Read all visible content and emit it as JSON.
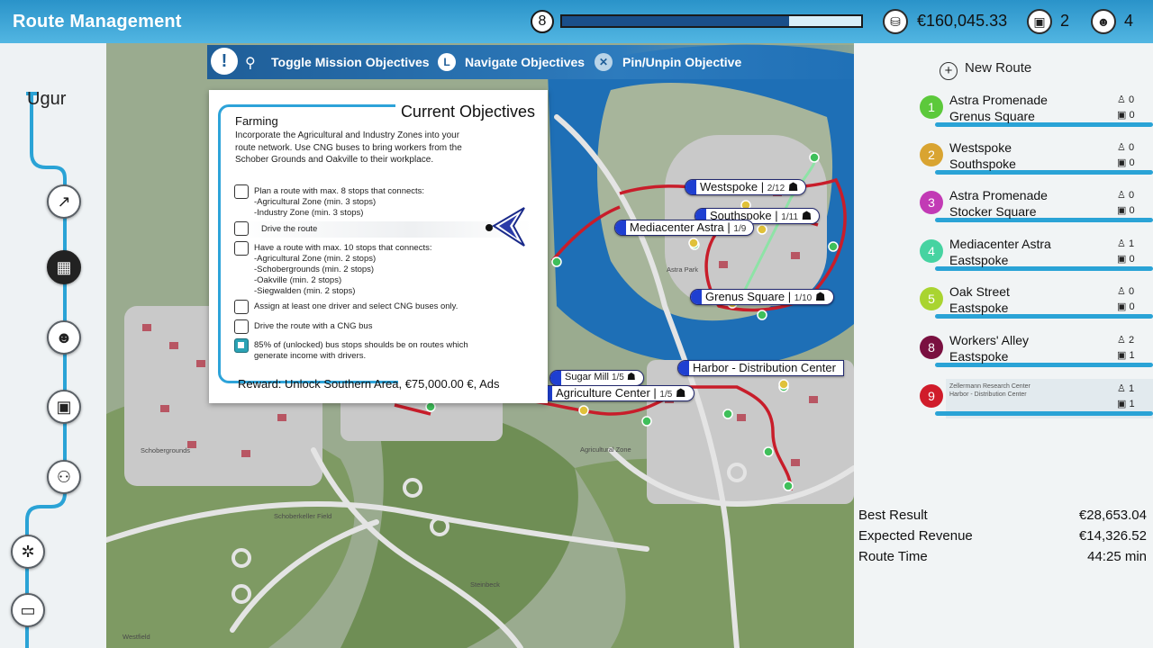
{
  "header": {
    "title": "Route Management",
    "level": "8",
    "xp_progress": 0.76,
    "money": "€160,045.33",
    "buses": "2",
    "drivers": "4"
  },
  "sidebar": {
    "company": "Ugur",
    "items": [
      {
        "icon": "statistics-icon"
      },
      {
        "icon": "map-icon",
        "active": true
      },
      {
        "icon": "driver-icon"
      },
      {
        "icon": "bus-icon"
      },
      {
        "icon": "people-icon"
      },
      {
        "icon": "settings-icon"
      },
      {
        "icon": "monitor-icon"
      }
    ]
  },
  "hints": {
    "toggle": "Toggle Mission Objectives",
    "navigate_key": "L",
    "navigate": "Navigate Objectives",
    "pin_key": "✕",
    "pin": "Pin/Unpin Objective"
  },
  "objectives": {
    "heading": "Current Objectives",
    "mission": "Farming",
    "description": "Incorporate the Agricultural and Industry Zones into your route network. Use CNG buses to bring workers from the Schober Grounds and Oakville to their workplace.",
    "tasks": [
      {
        "text": "Plan a route with max. 8 stops that connects:\n -Agricultural Zone (min. 3 stops)\n -Industry Zone (min. 3 stops)",
        "checked": false
      },
      {
        "text": "Drive the route",
        "checked": false
      },
      {
        "text": "Have a route with max. 10 stops that connects:\n -Agricultural Zone (min. 2 stops)\n -Schobergrounds (min. 2 stops)\n -Oakville (min. 2 stops)\n -Siegwalden (min. 2 stops)",
        "checked": false
      },
      {
        "text": "Assign at least one driver and select CNG buses only.",
        "checked": false
      },
      {
        "text": "Drive the route with a CNG bus",
        "checked": false
      },
      {
        "text": "85% of (unlocked) bus stops shoulds be on routes which generate income with drivers.",
        "checked": true
      }
    ],
    "reward": "Reward: Unlock Southern Area, €75,000.00 €, Ads"
  },
  "map_labels": [
    {
      "name": "Westspoke",
      "count": "2/12"
    },
    {
      "name": "Southspoke",
      "count": "1/11"
    },
    {
      "name": "Mediacenter Astra",
      "count": "1/9"
    },
    {
      "name": "Grenus Square",
      "count": "1/10"
    },
    {
      "name": "Harbor - Distribution Center",
      "count": ""
    },
    {
      "name": "Sugar Mill",
      "count": "1/5"
    },
    {
      "name": "Agriculture Center",
      "count": "1/5"
    }
  ],
  "map_area_names": [
    "Astra Park",
    "Agricultural Zone",
    "Schobergrounds",
    "Schoberkeller Field",
    "Steinbeck",
    "Westfield"
  ],
  "routes": {
    "new_route": "New Route",
    "items": [
      {
        "num": "1",
        "color": "#5cc93b",
        "line1": "Astra Promenade",
        "line2": "Grenus Square",
        "drivers": "0",
        "buses": "0"
      },
      {
        "num": "2",
        "color": "#d9a431",
        "line1": "Westspoke",
        "line2": "Southspoke",
        "drivers": "0",
        "buses": "0"
      },
      {
        "num": "3",
        "color": "#c23ab5",
        "line1": "Astra Promenade",
        "line2": "Stocker Square",
        "drivers": "0",
        "buses": "0"
      },
      {
        "num": "4",
        "color": "#46d3a1",
        "line1": "Mediacenter Astra",
        "line2": "Eastspoke",
        "drivers": "1",
        "buses": "0"
      },
      {
        "num": "5",
        "color": "#a9d430",
        "line1": "Oak Street",
        "line2": "Eastspoke",
        "drivers": "0",
        "buses": "0"
      },
      {
        "num": "8",
        "color": "#7a1040",
        "line1": "Workers' Alley",
        "line2": "Eastspoke",
        "drivers": "2",
        "buses": "1"
      },
      {
        "num": "9",
        "color": "#d01c2a",
        "line1": "Zellermann Research Center",
        "line2": "Harbor - Distribution Center",
        "drivers": "1",
        "buses": "1",
        "small": true
      }
    ]
  },
  "summary": {
    "best_result_label": "Best Result",
    "best_result": "€28,653.04",
    "revenue_label": "Expected Revenue",
    "revenue": "€14,326.52",
    "time_label": "Route Time",
    "time": "44:25 min"
  }
}
